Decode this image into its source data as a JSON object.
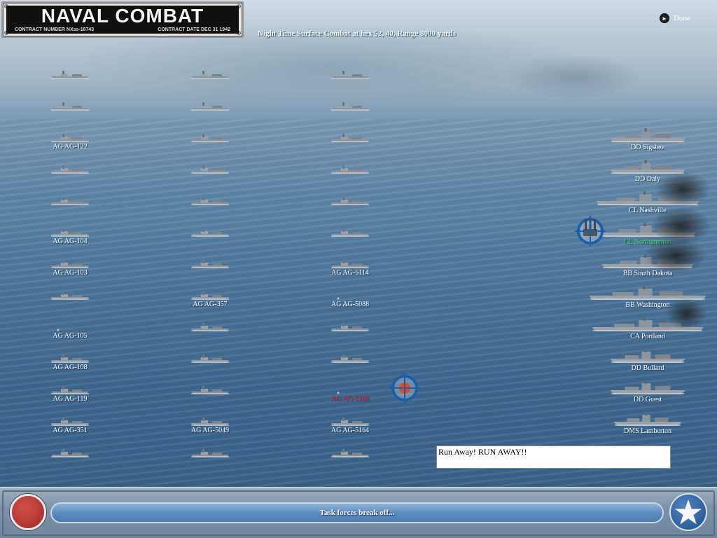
{
  "title": {
    "main": "NAVAL COMBAT",
    "contract_number": "CONTRACT NUMBER NXss-18743",
    "contract_date": "CONTRACT DATE DEC 31 1942"
  },
  "header": {
    "combat_info": "Night Time Surface Combat at hex 52, 40, Range 8000 yards",
    "done_label": "Done"
  },
  "enemy_ships": [
    {
      "label": ""
    },
    {
      "label": ""
    },
    {
      "label": ""
    },
    {
      "label": ""
    },
    {
      "label": ""
    },
    {
      "label": ""
    },
    {
      "label": "AG AG-122"
    },
    {
      "label": ""
    },
    {
      "label": ""
    },
    {
      "label": ""
    },
    {
      "label": ""
    },
    {
      "label": ""
    },
    {
      "label": ""
    },
    {
      "label": ""
    },
    {
      "label": ""
    },
    {
      "label": "AG AG-104"
    },
    {
      "label": ""
    },
    {
      "label": ""
    },
    {
      "label": "AG AG-103"
    },
    {
      "label": ""
    },
    {
      "label": "AG AG-5114"
    },
    {
      "label": ""
    },
    {
      "label": "AG AG-357"
    },
    {
      "label": "AG AG-5088"
    },
    {
      "label": "AG AG-105"
    },
    {
      "label": ""
    },
    {
      "label": ""
    },
    {
      "label": "AG AG-108"
    },
    {
      "label": ""
    },
    {
      "label": ""
    },
    {
      "label": "AG AG-119"
    },
    {
      "label": ""
    },
    {
      "label": "AG AG-5168"
    },
    {
      "label": "AG AG-351"
    },
    {
      "label": "AG AG-5049"
    },
    {
      "label": "AG AG-5164"
    },
    {
      "label": ""
    },
    {
      "label": ""
    },
    {
      "label": ""
    }
  ],
  "allied_ships": [
    {
      "label": "DD Sigsbee"
    },
    {
      "label": "DD Daly"
    },
    {
      "label": "CL Nashville"
    },
    {
      "label": "CL Northampton"
    },
    {
      "label": "BB South Dakota"
    },
    {
      "label": "BB Washington"
    },
    {
      "label": "CA Portland"
    },
    {
      "label": "DD Bullard"
    },
    {
      "label": "DD Guest"
    },
    {
      "label": "DMS Lamberton"
    }
  ],
  "message": "Run Away!  RUN AWAY!!",
  "status": "Task forces break off...",
  "colors": {
    "hit_label": "#e0262a",
    "active_label": "#39e05a",
    "sea": "#4b759b"
  },
  "icons": {
    "done": "arrow-circle-icon",
    "star": "star-icon",
    "target": "crosshair-icon",
    "gun": "gun-turret-icon"
  }
}
